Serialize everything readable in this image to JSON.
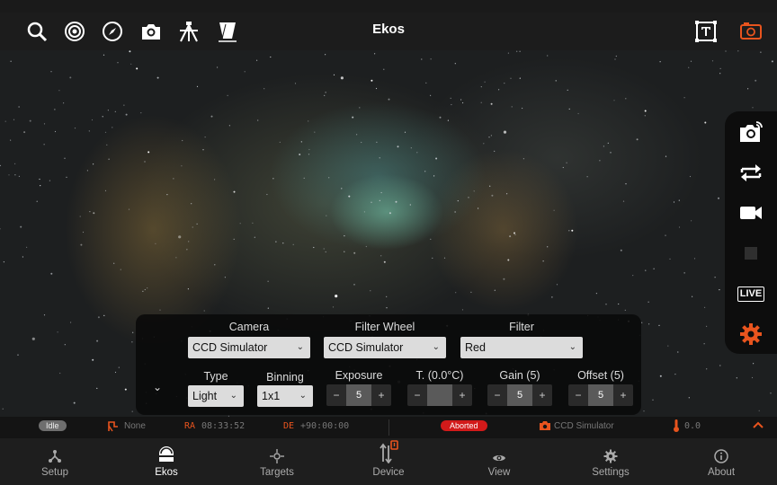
{
  "header": {
    "title": "Ekos"
  },
  "icons": {
    "search": "search-icon",
    "target": "target-icon",
    "compass": "compass-icon",
    "camera": "camera-icon",
    "tripod": "tripod-icon",
    "flat": "flat-panel-icon",
    "text": "text-overlay-icon",
    "frame": "frame-icon"
  },
  "side_buttons": [
    "capture-preview-icon",
    "loop-icon",
    "video-icon",
    "stop-icon",
    "live-icon",
    "settings-icon"
  ],
  "side_live_label": "LIVE",
  "capture": {
    "camera_label": "Camera",
    "camera_value": "CCD Simulator",
    "filterwheel_label": "Filter Wheel",
    "filterwheel_value": "CCD Simulator",
    "filter_label": "Filter",
    "filter_value": "Red",
    "type_label": "Type",
    "type_value": "Light",
    "binning_label": "Binning",
    "binning_value": "1x1",
    "exposure_label": "Exposure",
    "exposure_value": "5",
    "temp_label": "T. (0.0°C)",
    "temp_value": "",
    "gain_label": "Gain (5)",
    "gain_value": "5",
    "offset_label": "Offset (5)",
    "offset_value": "5",
    "minus": "−",
    "plus": "+"
  },
  "status": {
    "state": "Idle",
    "mount": "None",
    "ra_label": "RA",
    "ra_value": "08:33:52",
    "de_label": "DE",
    "de_value": "+90:00:00",
    "capture_state": "Aborted",
    "camera": "CCD Simulator",
    "temperature": "0.0"
  },
  "nav": [
    {
      "label": "Setup"
    },
    {
      "label": "Ekos"
    },
    {
      "label": "Targets"
    },
    {
      "label": "Device"
    },
    {
      "label": "View"
    },
    {
      "label": "Settings"
    },
    {
      "label": "About"
    }
  ],
  "colors": {
    "accent": "#e8541e",
    "aborted": "#d21a1a",
    "panel": "#0d0d0d"
  }
}
